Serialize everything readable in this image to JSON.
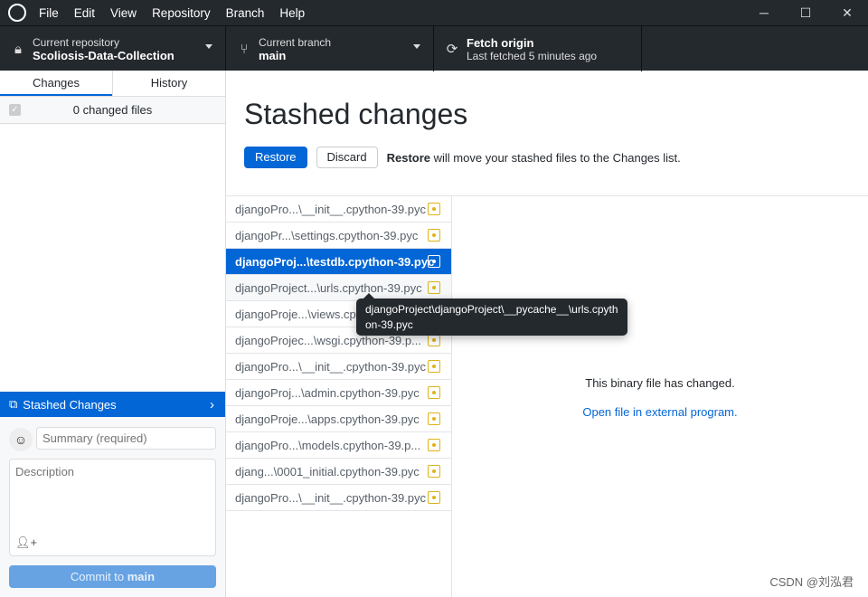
{
  "menu": [
    "File",
    "Edit",
    "View",
    "Repository",
    "Branch",
    "Help"
  ],
  "toolbar": {
    "repo": {
      "label": "Current repository",
      "value": "Scoliosis-Data-Collection"
    },
    "branch": {
      "label": "Current branch",
      "value": "main"
    },
    "fetch": {
      "label": "Fetch origin",
      "sub": "Last fetched 5 minutes ago"
    }
  },
  "sidebar": {
    "tabs": [
      "Changes",
      "History"
    ],
    "changed_files": "0 changed files",
    "stash_label": "Stashed Changes",
    "summary_placeholder": "Summary (required)",
    "description_placeholder": "Description",
    "commit_prefix": "Commit to ",
    "commit_branch": "main"
  },
  "main": {
    "title": "Stashed changes",
    "restore": "Restore",
    "discard": "Discard",
    "hint_bold": "Restore",
    "hint_rest": " will move your stashed files to the Changes list.",
    "files": [
      "djangoPro...\\__init__.cpython-39.pyc",
      "djangoPr...\\settings.cpython-39.pyc",
      "djangoProj...\\testdb.cpython-39.pyc",
      "djangoProject...\\urls.cpython-39.pyc",
      "djangoProje...\\views.cpython-39.pyc",
      "djangoProjec...\\wsgi.cpython-39.p...",
      "djangoPro...\\__init__.cpython-39.pyc",
      "djangoProj...\\admin.cpython-39.pyc",
      "djangoProje...\\apps.cpython-39.pyc",
      "djangoPro...\\models.cpython-39.p...",
      "djang...\\0001_initial.cpython-39.pyc",
      "djangoPro...\\__init__.cpython-39.pyc"
    ],
    "selected_index": 2,
    "tooltip": "djangoProject\\djangoProject\\__pycache__\\urls.cpython-39.pyc",
    "binary_msg": "This binary file has changed.",
    "open_external": "Open file in external program."
  },
  "watermark": "CSDN @刘泓君",
  "colors": {
    "accent": "#0366d6",
    "modified": "#dfb317",
    "chrome": "#24292e"
  }
}
